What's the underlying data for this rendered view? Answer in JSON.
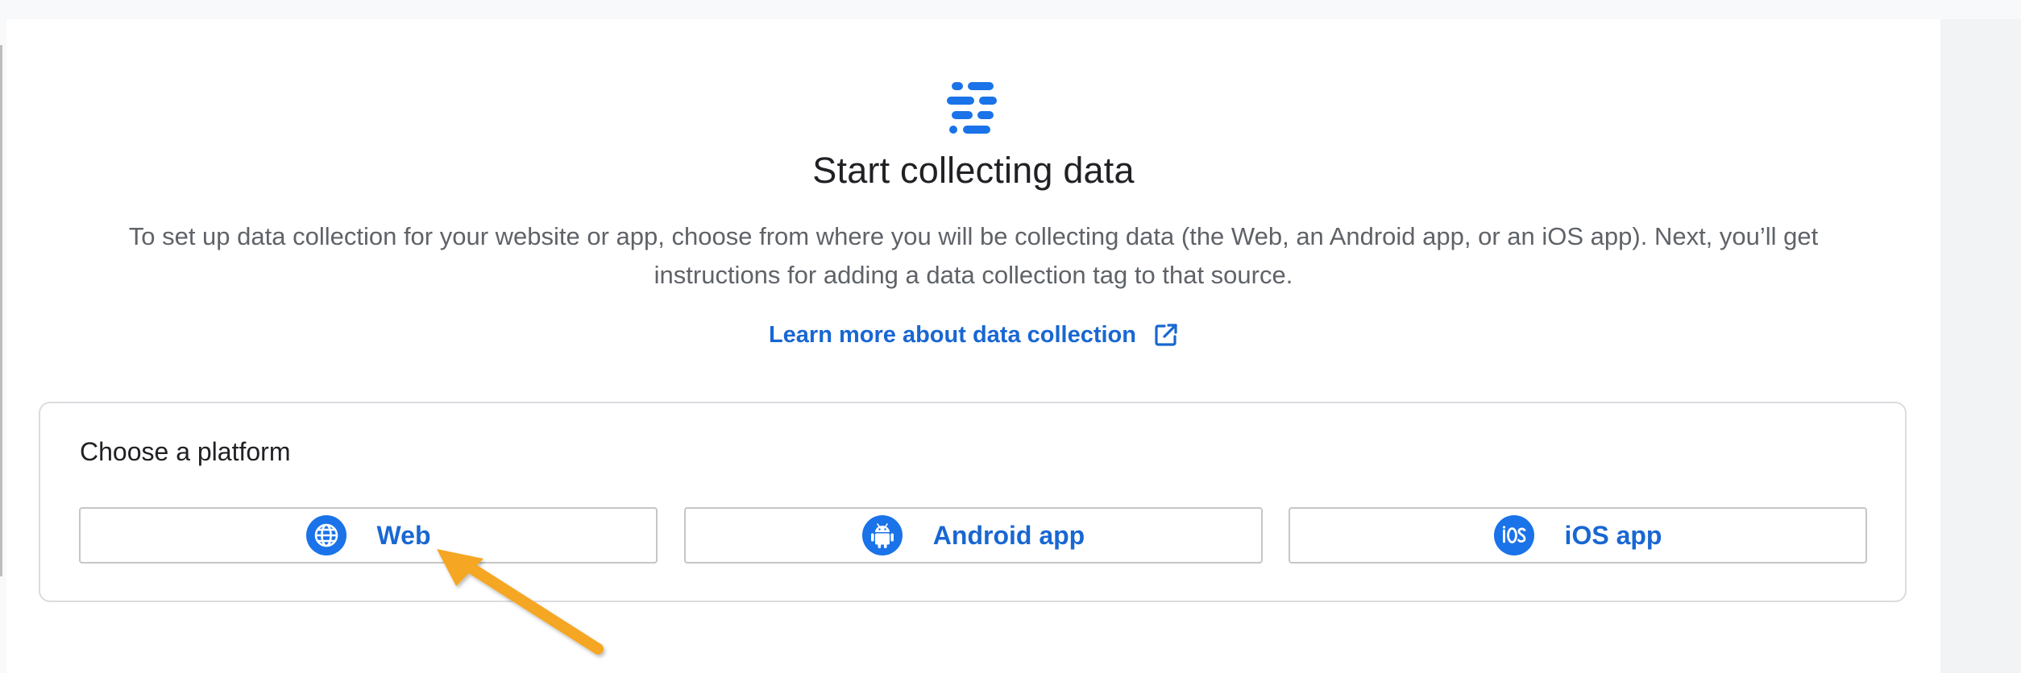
{
  "header": {
    "icon": "data-streams-icon",
    "title": "Start collecting data",
    "description": "To set up data collection for your website or app, choose from where you will be collecting data (the Web, an Android app, or an iOS app). Next, you’ll get instructions for adding a data collection tag to that source.",
    "learn_more_label": "Learn more about data collection",
    "learn_more_icon": "external-link-icon"
  },
  "platform_card": {
    "title": "Choose a platform",
    "options": [
      {
        "label": "Web",
        "icon": "globe-icon"
      },
      {
        "label": "Android app",
        "icon": "android-icon"
      },
      {
        "label": "iOS app",
        "icon": "ios-icon"
      }
    ]
  },
  "annotation": {
    "icon": "pointer-arrow-icon",
    "color": "#f5a623"
  },
  "colors": {
    "accent": "#1967d2",
    "title_text": "#202124",
    "body_text": "#5f6368",
    "border": "#dadce0"
  }
}
